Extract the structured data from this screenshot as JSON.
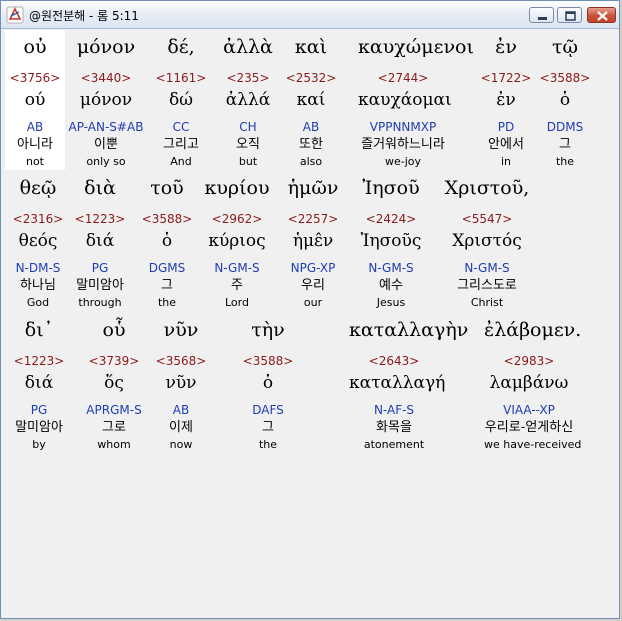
{
  "window": {
    "title": "@원전분해 - 롬 5:11",
    "buttons": {
      "minimize": "minimize",
      "maximize": "maximize",
      "close": "close"
    }
  },
  "interlinear": {
    "lines": [
      {
        "words": [
          {
            "greek": "οὐ",
            "strong": "<3756>",
            "lemma": "ού",
            "morph": "AB",
            "korean": "아니라",
            "english": "not",
            "selected": true
          },
          {
            "greek": "μόνον",
            "strong": "<3440>",
            "lemma": "μόνον",
            "morph": "AP-AN-S#AB",
            "korean": "이뿐",
            "english": "only so"
          },
          {
            "greek": "δέ,",
            "strong": "<1161>",
            "lemma": "δώ",
            "morph": "CC",
            "korean": "그리고",
            "english": "And"
          },
          {
            "greek": "ἀλλὰ",
            "strong": "<235>",
            "lemma": "ἀλλά",
            "morph": "CH",
            "korean": "오직",
            "english": "but"
          },
          {
            "greek": "καὶ",
            "strong": "<2532>",
            "lemma": "καί",
            "morph": "AB",
            "korean": "또한",
            "english": "also"
          },
          {
            "greek": "καυχώμενοι",
            "strong": "<2744>",
            "lemma": "καυχάομαι",
            "morph": "VPPNNMXP",
            "korean": "즐거워하느니라",
            "english": "we-joy"
          },
          {
            "greek": "ἐν",
            "strong": "<1722>",
            "lemma": "ἐν",
            "morph": "PD",
            "korean": "안에서",
            "english": "in"
          },
          {
            "greek": "τῷ",
            "strong": "<3588>",
            "lemma": "ὁ",
            "morph": "DDMS",
            "korean": "그",
            "english": "the"
          }
        ]
      },
      {
        "words": [
          {
            "greek": "θεῷ",
            "strong": "<2316>",
            "lemma": "θεός",
            "morph": "N-DM-S",
            "korean": "하나님",
            "english": "God"
          },
          {
            "greek": "διὰ",
            "strong": "<1223>",
            "lemma": "διά",
            "morph": "PG",
            "korean": "말미암아",
            "english": "through"
          },
          {
            "greek": "τοῦ",
            "strong": "<3588>",
            "lemma": "ὁ",
            "morph": "DGMS",
            "korean": "그",
            "english": "the"
          },
          {
            "greek": "κυρίου",
            "strong": "<2962>",
            "lemma": "κύριος",
            "morph": "N-GM-S",
            "korean": "주",
            "english": "Lord"
          },
          {
            "greek": "ἡμῶν",
            "strong": "<2257>",
            "lemma": "ἡμε̂ν",
            "morph": "NPG-XP",
            "korean": "우리",
            "english": "our"
          },
          {
            "greek": "Ἰησοῦ",
            "strong": "<2424>",
            "lemma": "Ἰησοῦς",
            "morph": "N-GM-S",
            "korean": "예수",
            "english": "Jesus"
          },
          {
            "greek": "Χριστοῦ,",
            "strong": "<5547>",
            "lemma": "Χριστός",
            "morph": "N-GM-S",
            "korean": "그리스도로",
            "english": "Christ"
          }
        ]
      },
      {
        "words": [
          {
            "greek": "δι᾽",
            "strong": "<1223>",
            "lemma": "διά",
            "morph": "PG",
            "korean": "말미암아",
            "english": "by"
          },
          {
            "greek": "οὗ",
            "strong": "<3739>",
            "lemma": "ὅς",
            "morph": "APRGM-S",
            "korean": "그로",
            "english": "whom"
          },
          {
            "greek": "νῦν",
            "strong": "<3568>",
            "lemma": "νῦν",
            "morph": "AB",
            "korean": "이제",
            "english": "now"
          },
          {
            "greek": "τὴν",
            "strong": "<3588>",
            "lemma": "ὁ",
            "morph": "DAFS",
            "korean": "그",
            "english": "the"
          },
          {
            "greek": "καταλλαγὴν",
            "strong": "<2643>",
            "lemma": "καταλλαγή",
            "morph": "N-AF-S",
            "korean": "화목을",
            "english": "atonement"
          },
          {
            "greek": "ἐλάβομεν.",
            "strong": "<2983>",
            "lemma": "λαμβάνω",
            "morph": "VIAA--XP",
            "korean": "우리로-얻게하신",
            "english": "we have-received"
          }
        ]
      }
    ]
  },
  "colors": {
    "strong": "#8b1a1a",
    "morph": "#1f3cb4",
    "background": "#f0f0f0",
    "selected": "#ffffff"
  }
}
